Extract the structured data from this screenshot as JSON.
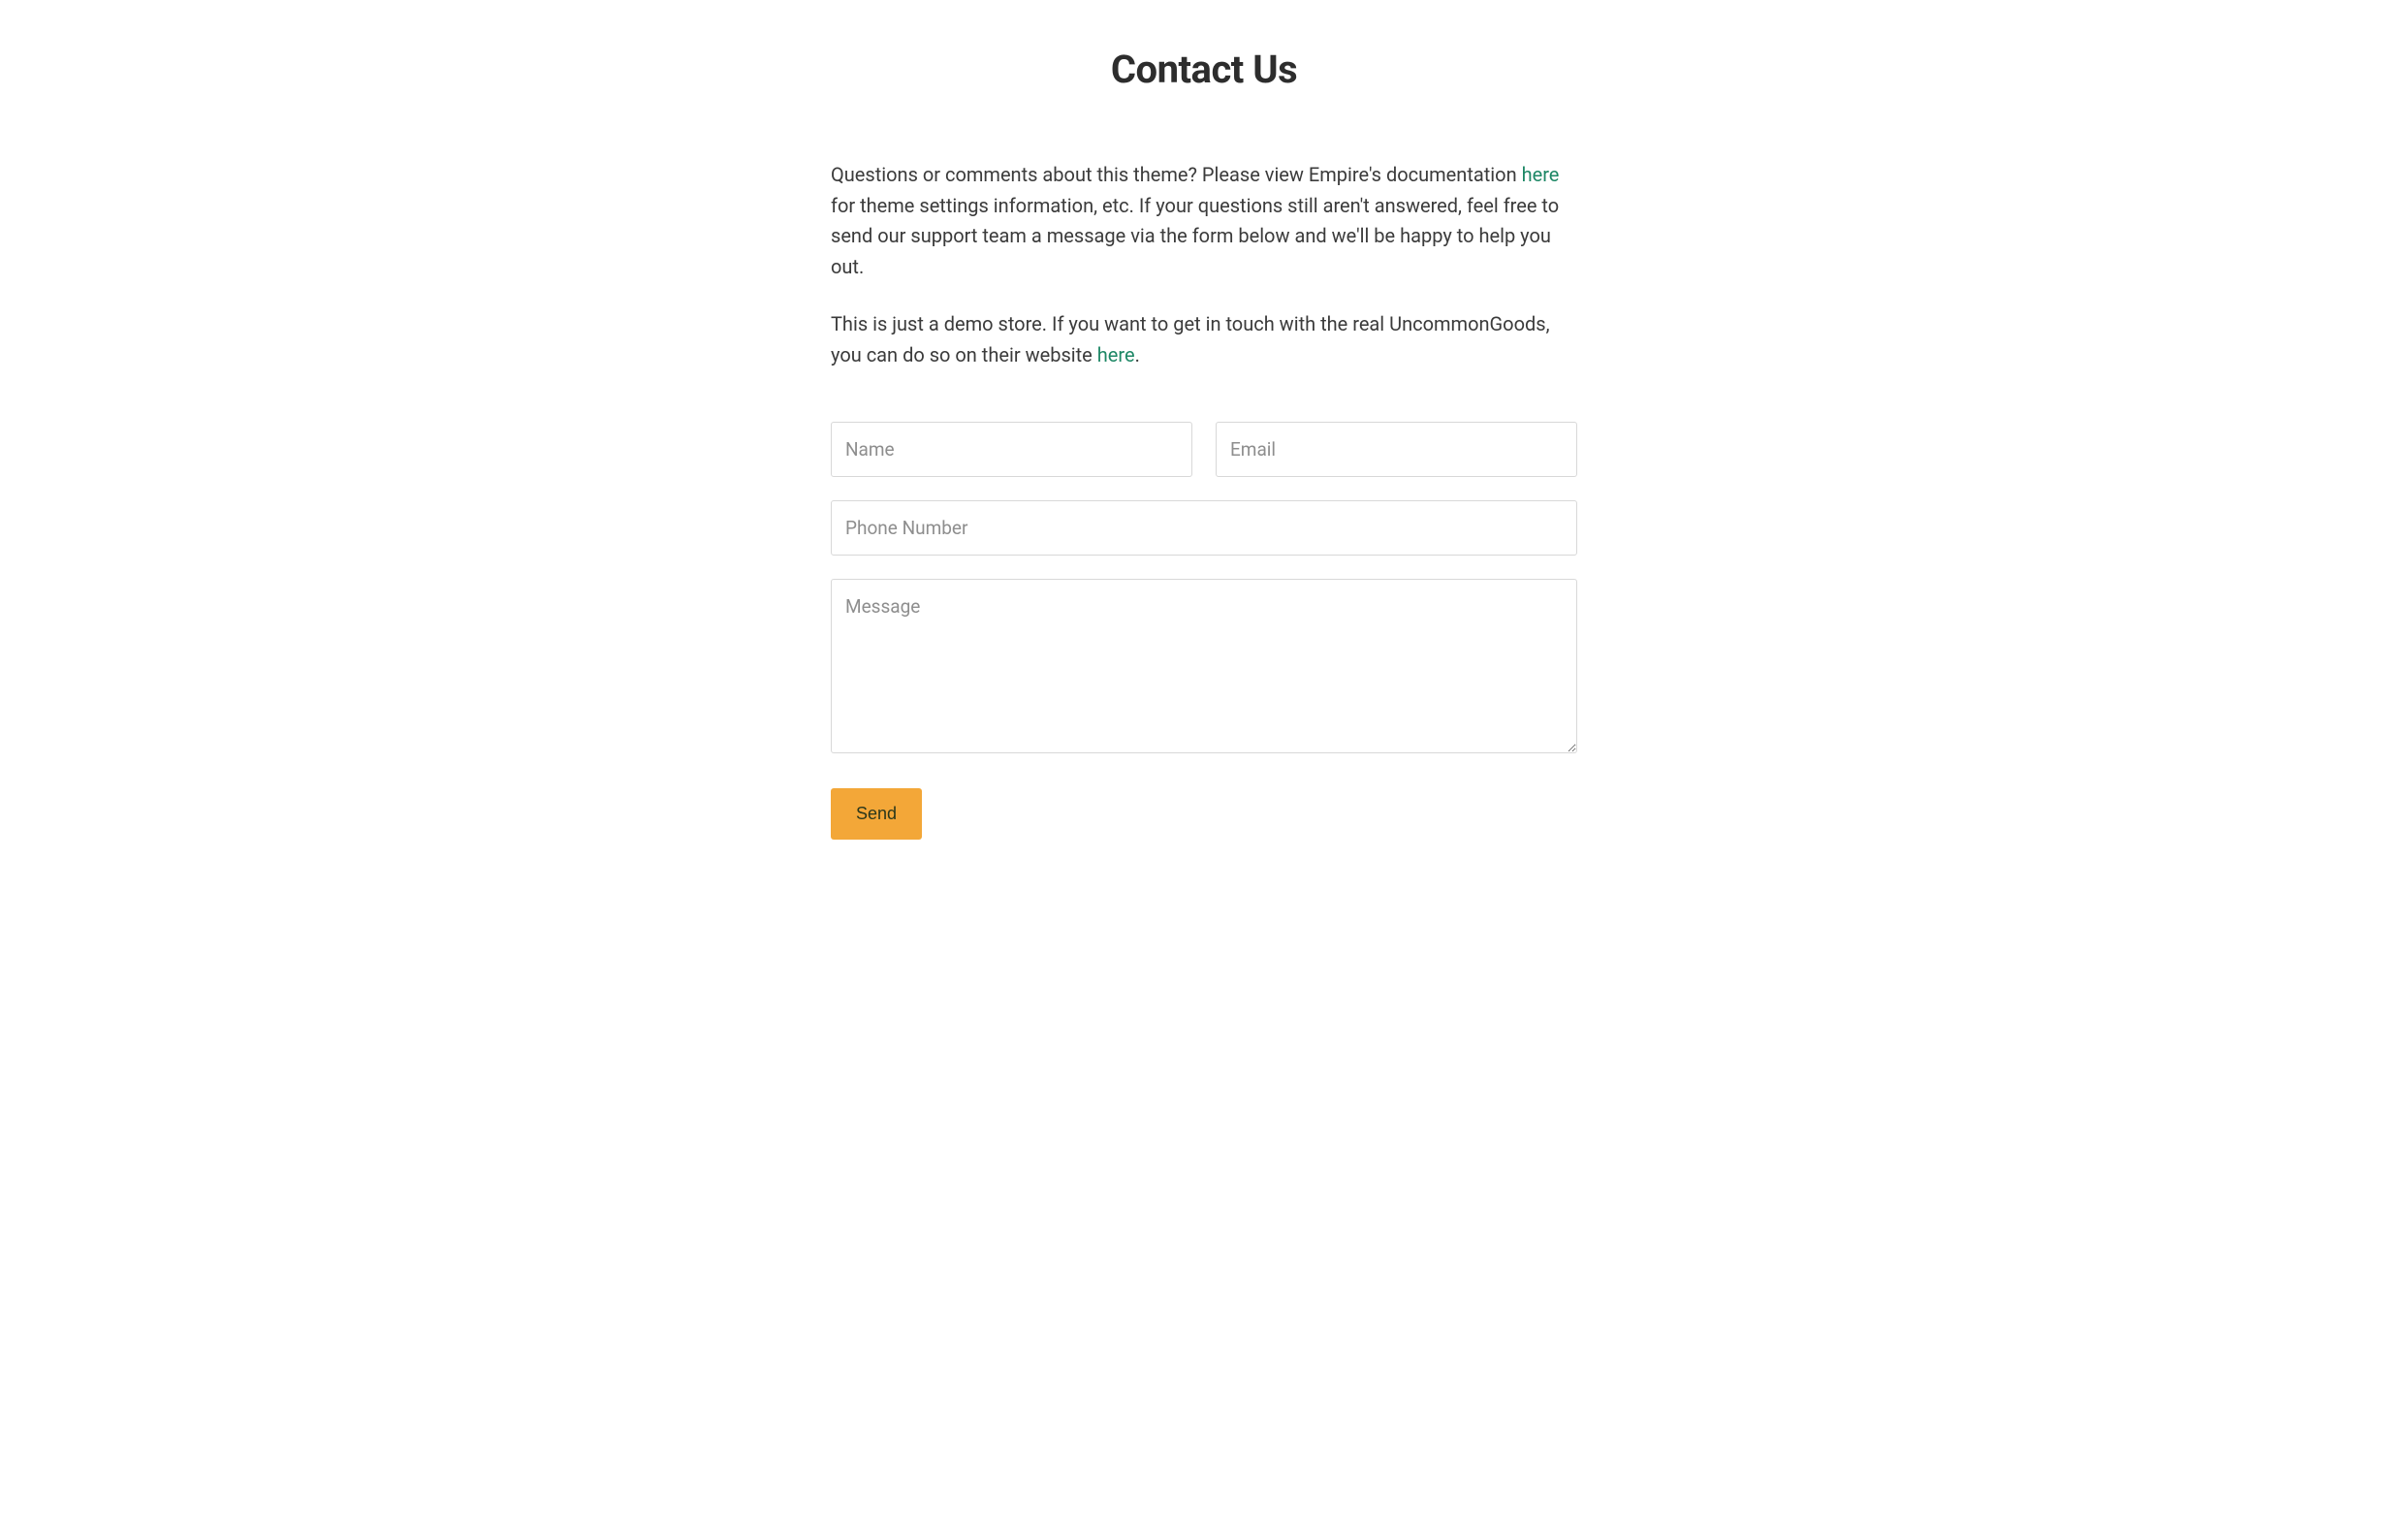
{
  "page": {
    "title": "Contact Us"
  },
  "intro": {
    "p1_before": "Questions or comments about this theme? Please view Empire's documentation ",
    "p1_link": "here",
    "p1_after": " for theme settings information, etc. If your questions still aren't answered, feel free to send our support team a message via the form below and we'll be happy to help you out.",
    "p2_before": "This is just a demo store. If you want to get in touch with the real UncommonGoods, you can do so on their website ",
    "p2_link": "here",
    "p2_after": "."
  },
  "form": {
    "name_placeholder": "Name",
    "email_placeholder": "Email",
    "phone_placeholder": "Phone Number",
    "message_placeholder": "Message",
    "submit_label": "Send"
  }
}
